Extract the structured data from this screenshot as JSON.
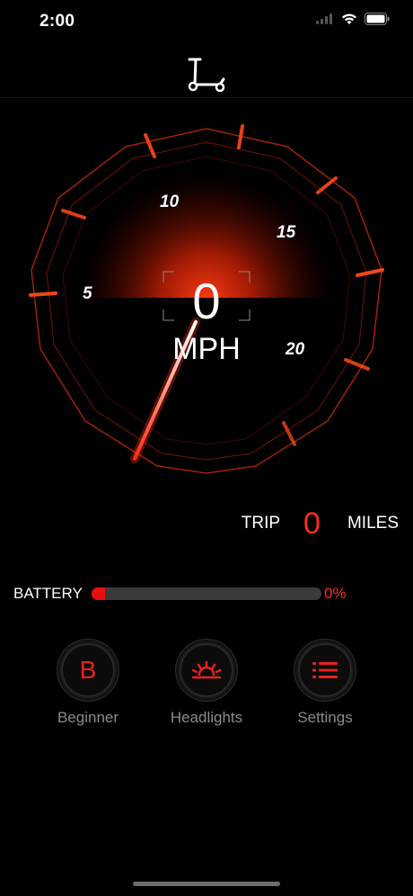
{
  "status_bar": {
    "time": "2:00",
    "icons": [
      "signal-icon",
      "wifi-icon",
      "battery-icon"
    ]
  },
  "header": {
    "icon": "scooter-icon"
  },
  "gauge": {
    "speed": "0",
    "unit": "MPH",
    "ticks": [
      "5",
      "10",
      "15",
      "20"
    ],
    "needle_value": 0,
    "accent_color": "#ff3a12"
  },
  "trip": {
    "label": "TRIP",
    "value": "0",
    "unit": "MILES"
  },
  "battery": {
    "label": "BATTERY",
    "percent_text": "0%",
    "level": 0.06,
    "fill_color": "#e8100f"
  },
  "modes": [
    {
      "label": "Beginner",
      "icon": "beginner-b-icon",
      "letter": "B"
    },
    {
      "label": "Headlights",
      "icon": "headlights-icon"
    },
    {
      "label": "Settings",
      "icon": "settings-list-icon"
    }
  ]
}
